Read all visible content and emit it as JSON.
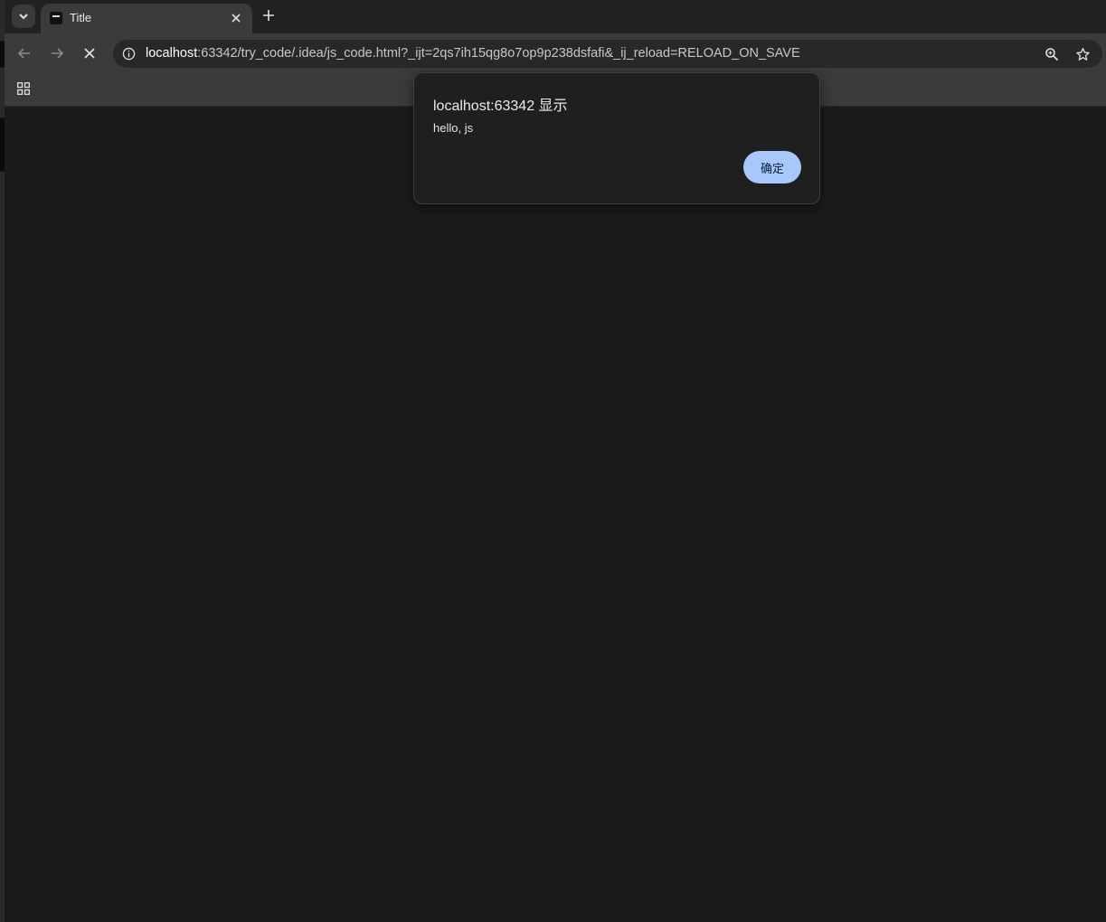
{
  "tabs": [
    {
      "title": "Title",
      "active": true
    }
  ],
  "toolbar": {
    "url_host": "localhost",
    "url_rest": ":63342/try_code/.idea/js_code.html?_ijt=2qs7ih15qg8o7op9p238dsfafi&_ij_reload=RELOAD_ON_SAVE",
    "loading": true,
    "icons": {
      "back": "arrow-left-icon",
      "forward": "arrow-right-icon",
      "stop": "close-icon",
      "site_info": "info-icon",
      "zoom": "zoom-icon",
      "bookmark": "star-icon"
    }
  },
  "bookmarks_bar": {
    "apps_icon": "apps-grid-icon"
  },
  "dialog": {
    "title": "localhost:63342 显示",
    "message": "hello, js",
    "ok_label": "确定"
  },
  "colors": {
    "content_bg": "#1b1b1b",
    "toolbar_bg": "#3b3b3b",
    "tabstrip_bg": "#212121",
    "dialog_button": "#a8c7fa"
  }
}
